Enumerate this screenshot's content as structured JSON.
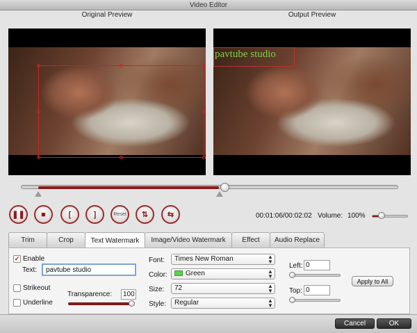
{
  "window": {
    "title": "Video Editor"
  },
  "preview": {
    "original_label": "Original Preview",
    "output_label": "Output Preview",
    "watermark_text": "pavtube studio",
    "watermark_color": "#7fd04a"
  },
  "playback": {
    "timecode": "00:01:06/00:02:02",
    "progress_fraction": 0.54,
    "volume_label": "Volume:",
    "volume_value": "100%",
    "volume_fraction": 0.2,
    "reset_label": "Reset"
  },
  "tabs": [
    {
      "label": "Trim"
    },
    {
      "label": "Crop"
    },
    {
      "label": "Text Watermark",
      "active": true
    },
    {
      "label": "Image/Video Watermark"
    },
    {
      "label": "Effect"
    },
    {
      "label": "Audio Replace"
    }
  ],
  "watermark_form": {
    "enable_label": "Enable",
    "enable_checked": true,
    "text_label": "Text:",
    "text_value": "pavtube studio",
    "strikeout_label": "Strikeout",
    "underline_label": "Underline",
    "transparence_label": "Transparence:",
    "transparence_value": "100",
    "font_label": "Font:",
    "font_value": "Times New Roman",
    "color_label": "Color:",
    "color_value": "Green",
    "color_swatch": "#55d64a",
    "size_label": "Size:",
    "size_value": "72",
    "style_label": "Style:",
    "style_value": "Regular",
    "left_label": "Left:",
    "left_value": "0",
    "top_label": "Top:",
    "top_value": "0",
    "apply_all_label": "Apply to All"
  },
  "dialog": {
    "cancel_label": "Cancel",
    "ok_label": "OK"
  },
  "colors": {
    "accent": "#8b1b1b",
    "selection": "#cc2222"
  }
}
